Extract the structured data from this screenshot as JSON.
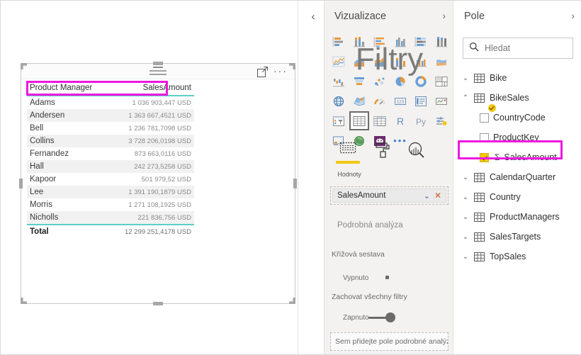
{
  "canvas": {
    "visual": {
      "header_icons": [
        "drag-grip",
        "focus-mode-icon",
        "more-options-icon"
      ],
      "columns": [
        "Product Manager",
        "SalesAmount"
      ],
      "rows": [
        {
          "name": "Adams",
          "value": "1 036 903,447 USD"
        },
        {
          "name": "Andersen",
          "value": "1 363 667,4521 USD"
        },
        {
          "name": "Bell",
          "value": "1 236 781,7098 USD"
        },
        {
          "name": "Collins",
          "value": "3 728 206,0198 USD"
        },
        {
          "name": "Fernandez",
          "value": "873 663,0116 USD"
        },
        {
          "name": "Hall",
          "value": "242 273,5258 USD"
        },
        {
          "name": "Kapoor",
          "value": "501 979,52 USD"
        },
        {
          "name": "Lee",
          "value": "1 391 190,1879 USD"
        },
        {
          "name": "Morris",
          "value": "1 271 108,1925 USD"
        },
        {
          "name": "Nicholls",
          "value": "221 836,756 USD"
        }
      ],
      "total": {
        "name": "Total",
        "value": "12 299 251,4178 USD"
      }
    }
  },
  "pane_collapse": {
    "glyph": "‹"
  },
  "visualizations": {
    "title": "Vizualizace",
    "chevron": "›",
    "watermark": "Filtry",
    "gallery": [
      "stacked-bar-chart-icon",
      "stacked-column-chart-icon",
      "clustered-bar-chart-icon",
      "clustered-column-chart-icon",
      "hundred-percent-stacked-bar-chart-icon",
      "hundred-percent-stacked-column-chart-icon",
      "line-chart-icon",
      "area-chart-icon",
      "stacked-area-chart-icon",
      "line-stacked-column-chart-icon",
      "line-clustered-column-chart-icon",
      "ribbon-chart-icon",
      "waterfall-chart-icon",
      "funnel-chart-icon",
      "scatter-chart-icon",
      "pie-chart-icon",
      "donut-chart-icon",
      "treemap-icon",
      "map-icon",
      "filled-map-icon",
      "gauge-icon",
      "card-icon",
      "multi-row-card-icon",
      "kpi-icon",
      "slicer-icon",
      "table-icon",
      "matrix-icon",
      "r-script-visual-icon",
      "python-visual-icon",
      "key-influencers-icon",
      "decomposition-tree-icon",
      "arcgis-map-icon",
      "paginated-report-icon",
      "more-visuals-icon"
    ],
    "selected_gallery_item": "table-icon",
    "well_tabs": [
      "fields-tab-icon",
      "format-paintbrush-icon",
      "analytics-magnifier-icon"
    ],
    "well_tab_label": "Hodnoty",
    "well_field": {
      "label": "SalesAmount",
      "chevron": "⌄",
      "remove": "✕"
    },
    "drillthrough_heading": "Podrobná analýza",
    "cross_report_label": "Křížová sestava",
    "cross_report_state": "Vypnuto",
    "keep_filters_label": "Zachovat všechny filtry",
    "keep_filters_state": "Zapnuto",
    "drill_drop_placeholder": "Sem přidejte pole podrobné analýzy"
  },
  "fields": {
    "title": "Pole",
    "chevron": "›",
    "search": {
      "placeholder": "Hledat",
      "icon": "search-icon"
    },
    "tables": [
      {
        "label": "Bike",
        "expanded": false,
        "chevron": "⌄",
        "checked_table": false
      },
      {
        "label": "BikeSales",
        "expanded": true,
        "chevron": "⌃",
        "checked_table": true
      },
      {
        "label": "CalendarQuarter",
        "expanded": false,
        "chevron": "⌄",
        "checked_table": false
      },
      {
        "label": "Country",
        "expanded": false,
        "chevron": "⌄",
        "checked_table": false
      },
      {
        "label": "ProductManagers",
        "expanded": false,
        "chevron": "⌄",
        "checked_table": false
      },
      {
        "label": "SalesTargets",
        "expanded": false,
        "chevron": "⌄",
        "checked_table": false
      },
      {
        "label": "TopSales",
        "expanded": false,
        "chevron": "⌄",
        "checked_table": false
      }
    ],
    "bikesales_children": [
      {
        "label": "CountryCode",
        "checked": false,
        "measure": false
      },
      {
        "label": "ProductKey",
        "checked": false,
        "measure": false
      },
      {
        "label": "SalesAmount",
        "checked": true,
        "measure": true,
        "sigma": "Σ"
      }
    ]
  },
  "colors": {
    "highlight": "#EE18E0",
    "accent_teal": "#5CCFCB",
    "accent_yellow": "#F2C811",
    "pane_bg": "#F3F2F1"
  }
}
